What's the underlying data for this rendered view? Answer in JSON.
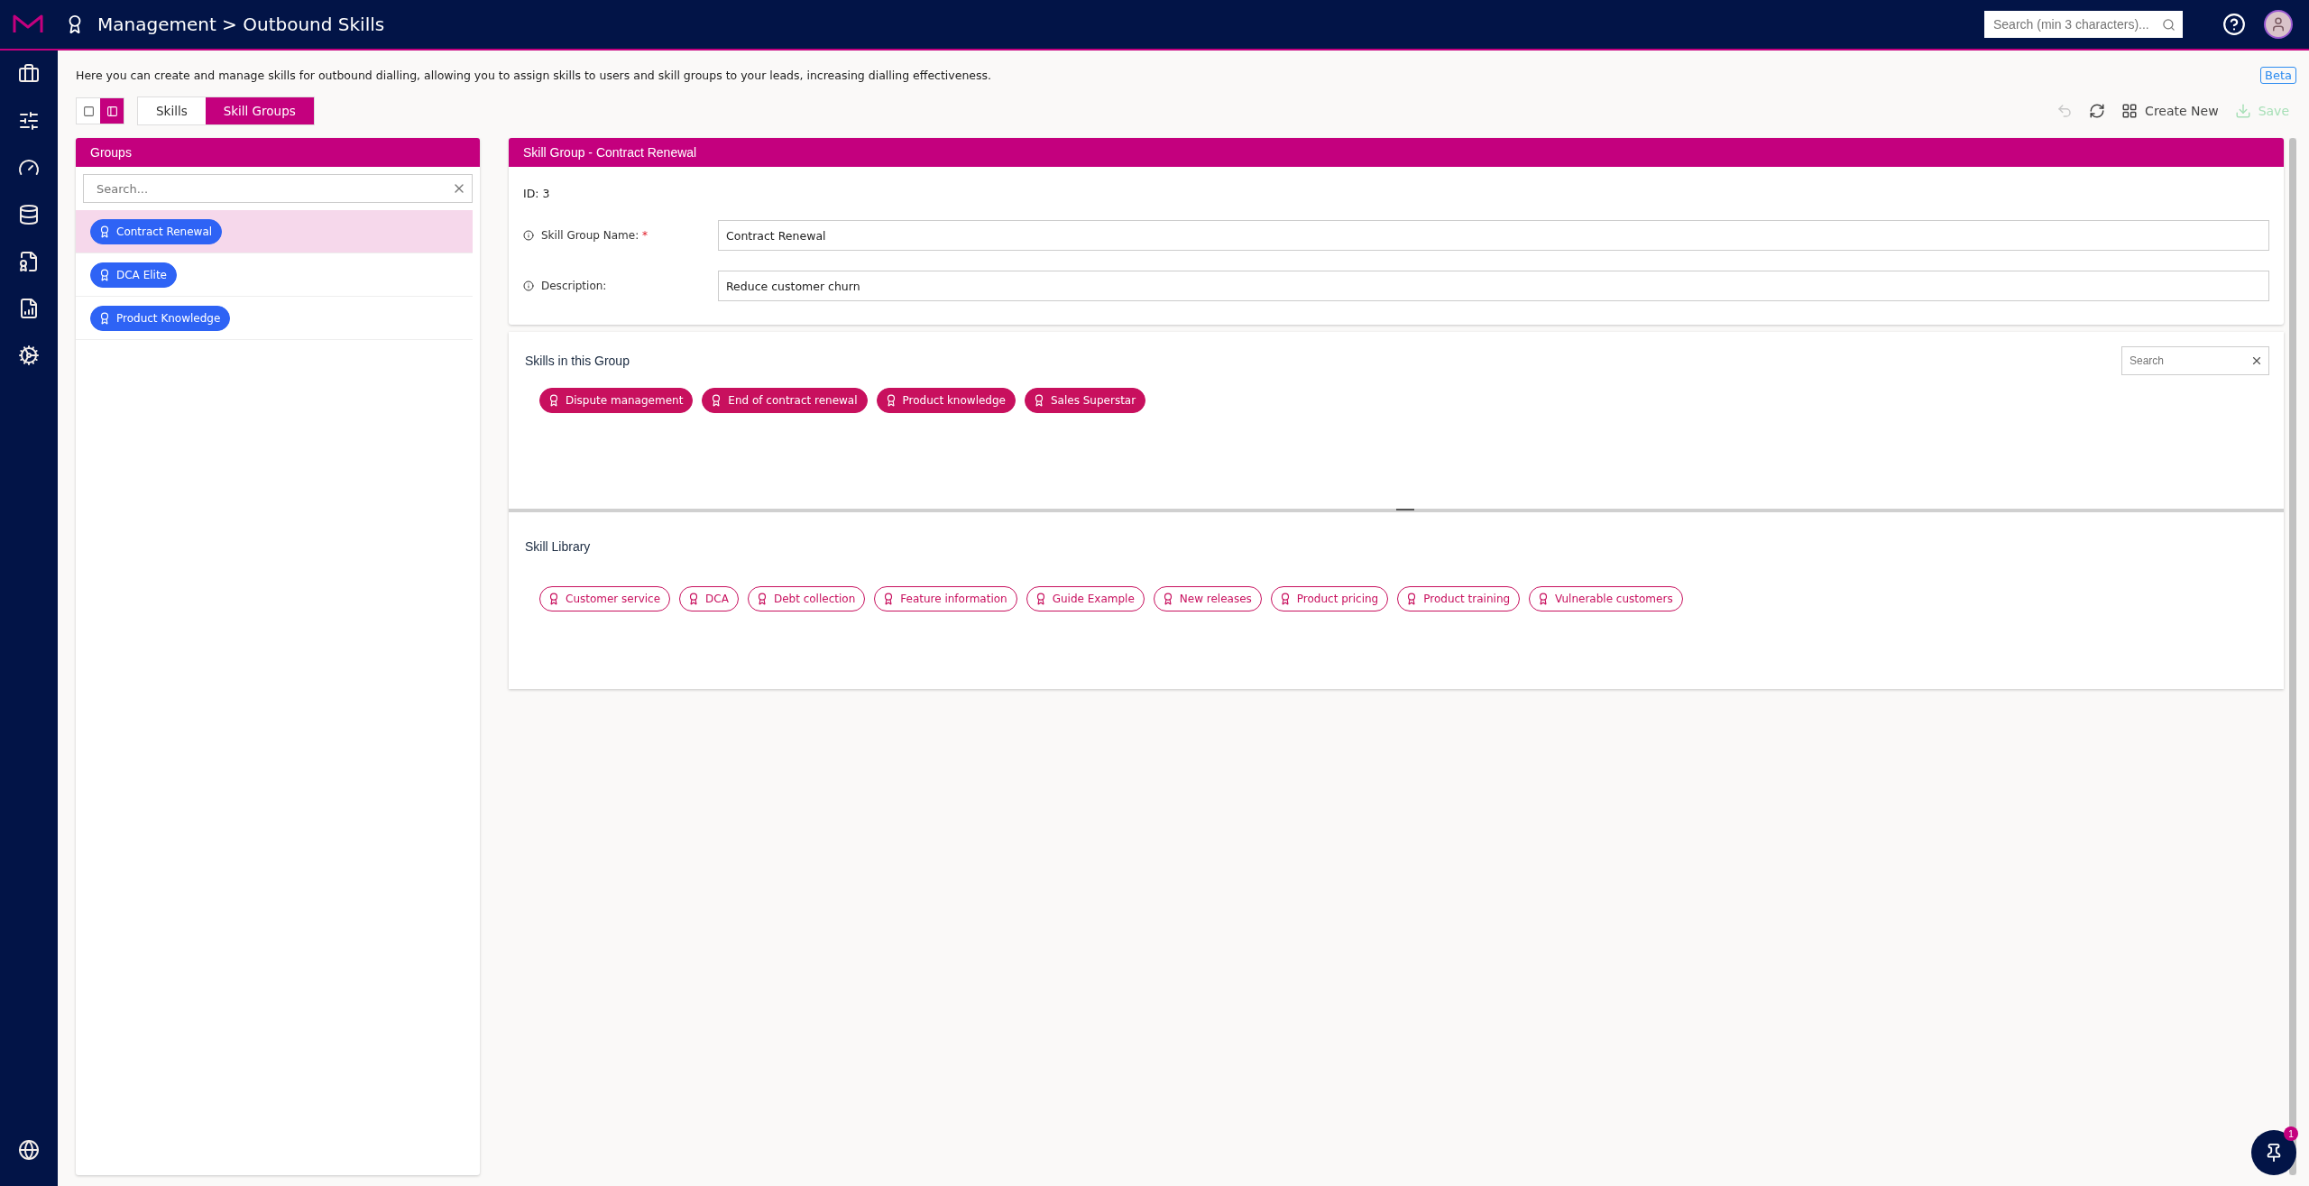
{
  "topbar": {
    "breadcrumb": "Management > Outbound Skills",
    "search": {
      "placeholder": "Search (min 3 characters)..."
    }
  },
  "intro": "Here you can create and manage skills for outbound dialling, allowing you to assign skills to users and skill groups to your leads, increasing dialling effectiveness.",
  "beta_badge": "Beta",
  "view_toggle": [
    {
      "kind": "single",
      "selected": false
    },
    {
      "kind": "split",
      "selected": true
    }
  ],
  "tabs": [
    {
      "label": "Skills",
      "selected": false
    },
    {
      "label": "Skill Groups",
      "selected": true
    }
  ],
  "actions": [
    {
      "kind": "undo",
      "disabled": true
    },
    {
      "kind": "refresh",
      "disabled": false
    },
    {
      "kind": "create",
      "label": "Create New",
      "disabled": false
    },
    {
      "kind": "save",
      "label": "Save",
      "disabled": true
    }
  ],
  "groups_panel": {
    "title": "Groups",
    "search": {
      "placeholder": "Search..."
    },
    "items": [
      {
        "label": "Contract Renewal",
        "selected": true
      },
      {
        "label": "DCA Elite",
        "selected": false
      },
      {
        "label": "Product Knowledge",
        "selected": false
      }
    ]
  },
  "detail": {
    "title": "Skill Group - Contract Renewal",
    "id_text": "ID: 3",
    "fields": [
      {
        "label": "Skill Group Name:",
        "required_mark": "*",
        "value": "Contract Renewal"
      },
      {
        "label": "Description:",
        "value": "Reduce customer churn"
      }
    ]
  },
  "skills_in_group": {
    "title": "Skills in this Group",
    "search": {
      "placeholder": "Search"
    },
    "skills": [
      "Dispute management",
      "End of contract renewal",
      "Product knowledge",
      "Sales Superstar"
    ]
  },
  "skill_library": {
    "title": "Skill Library",
    "skills": [
      "Customer service",
      "DCA",
      "Debt collection",
      "Feature information",
      "Guide Example",
      "New releases",
      "Product pricing",
      "Product training",
      "Vulnerable customers"
    ]
  },
  "pin_button": {
    "badge": "1"
  }
}
